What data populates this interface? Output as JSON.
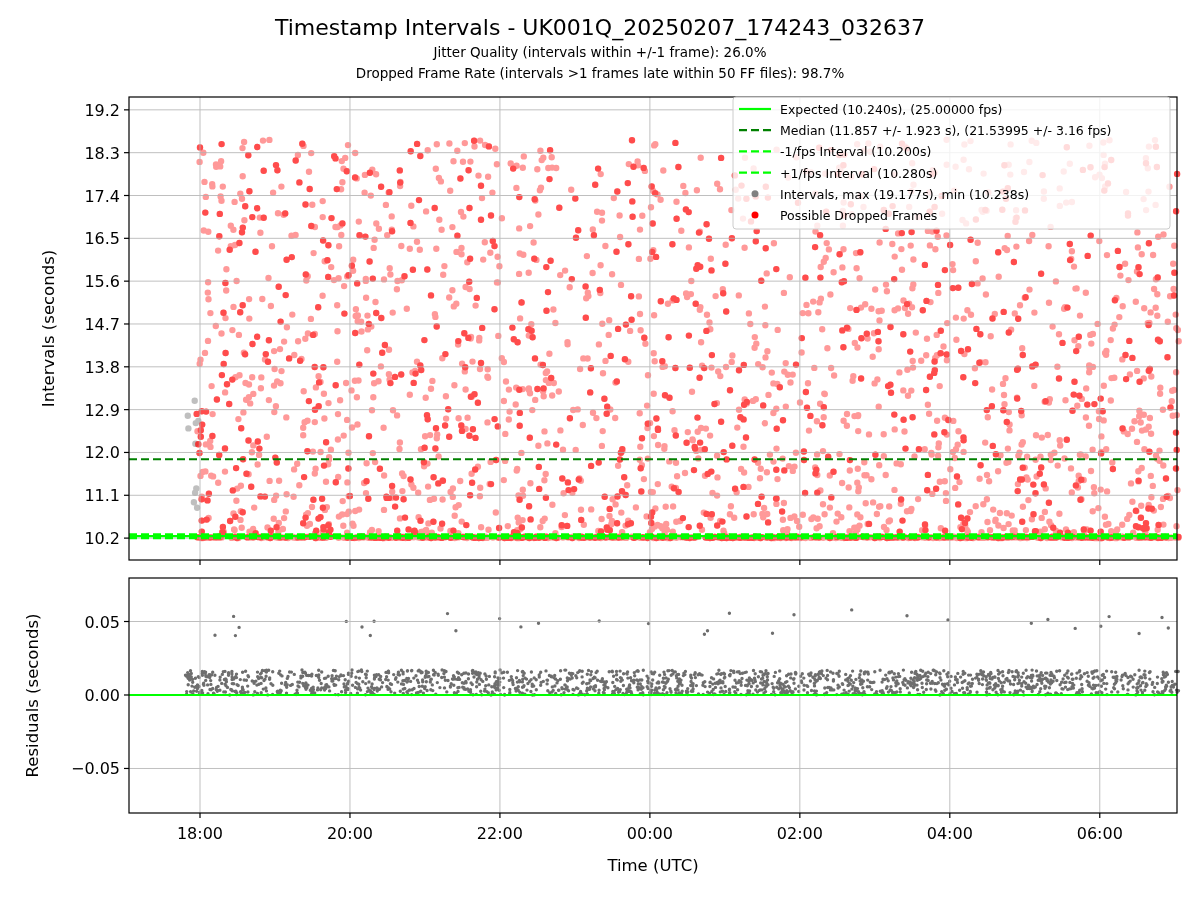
{
  "title": "Timestamp Intervals - UK001Q_20250207_174243_032637",
  "subtitles": [
    "Jitter Quality (intervals within +/-1 frame): 26.0%",
    "Dropped Frame Rate (intervals >1 frames late within 50 FF files): 98.7%"
  ],
  "intervals_plot": {
    "chart_data": {
      "type": "line",
      "ylabel": "Intervals (seconds)",
      "grid": true,
      "x": [
        "2025-02-07T17:03:11Z",
        "2025-02-08T07:01:48Z"
      ],
      "xlim": [
        "2025-02-07T17:03:11Z",
        "2025-02-08T07:01:48Z"
      ],
      "ylim": [
        9.74,
        19.47
      ],
      "yticks": [
        {
          "value": 10.2,
          "label": "10.2"
        },
        {
          "value": 11.1,
          "label": "11.1"
        },
        {
          "value": 12,
          "label": "12.0"
        },
        {
          "value": 12.9,
          "label": "12.9"
        },
        {
          "value": 13.8,
          "label": "13.8"
        },
        {
          "value": 14.7,
          "label": "14.7"
        },
        {
          "value": 15.6,
          "label": "15.6"
        },
        {
          "value": 16.5,
          "label": "16.5"
        },
        {
          "value": 17.4,
          "label": "17.4"
        },
        {
          "value": 18.3,
          "label": "18.3"
        },
        {
          "value": 19.2,
          "label": "19.2"
        }
      ],
      "legend": "upper right",
      "series": [
        {
          "name": "Expected (10.240s), (25.00000 fps)",
          "color": "#00ff00",
          "line_style": "solid",
          "values": [
            10.24,
            10.24
          ]
        },
        {
          "name": "Median (11.857 +/- 1.923 s), (21.53995 +/- 3.16 fps)",
          "color": "#008000",
          "line_style": "dashed",
          "values": [
            11.857,
            11.857
          ]
        },
        {
          "name": "-1/fps Interval (10.200s)",
          "color": "#00ff00",
          "line_style": "dashed",
          "values": [
            10.2,
            10.2
          ]
        },
        {
          "name": "+1/fps Interval (10.280s)",
          "color": "#00ff00",
          "line_style": "dashed",
          "values": [
            10.28,
            10.28
          ]
        }
      ]
    },
    "point_legend": [
      {
        "label": "Intervals, max (19.177s), min (10.238s)",
        "color": "#808080"
      },
      {
        "label": "Possible Dropped Frames",
        "color": "#ff0000"
      }
    ]
  },
  "residuals_plot": {
    "chart_data": {
      "type": "line",
      "ylabel": "Residuals (seconds)",
      "xlabel": "Time (UTC)",
      "grid": true,
      "x": [
        "2025-02-07T17:03:11Z",
        "2025-02-08T07:01:48Z"
      ],
      "xlim": [
        "2025-02-07T17:03:11Z",
        "2025-02-08T07:01:48Z"
      ],
      "ylim": [
        -0.0803,
        0.0796
      ],
      "xticks": [
        {
          "value": "2025-02-07T18:00:00Z",
          "label": "18:00"
        },
        {
          "value": "2025-02-07T20:00:00Z",
          "label": "20:00"
        },
        {
          "value": "2025-02-07T22:00:00Z",
          "label": "22:00"
        },
        {
          "value": "2025-02-08T00:00:00Z",
          "label": "00:00"
        },
        {
          "value": "2025-02-08T02:00:00Z",
          "label": "02:00"
        },
        {
          "value": "2025-02-08T04:00:00Z",
          "label": "04:00"
        },
        {
          "value": "2025-02-08T06:00:00Z",
          "label": "06:00"
        }
      ],
      "yticks": [
        {
          "value": -0.05,
          "label": "−0.05"
        },
        {
          "value": 0,
          "label": "0.00"
        },
        {
          "value": 0.05,
          "label": "0.05"
        }
      ],
      "series": [
        {
          "color": "#00ff00",
          "values": [
            0,
            0
          ]
        }
      ]
    }
  }
}
